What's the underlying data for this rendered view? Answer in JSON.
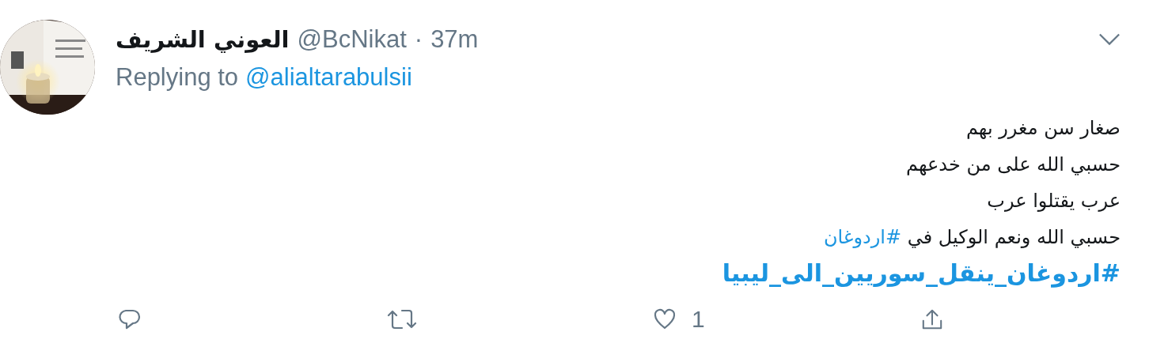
{
  "tweet": {
    "author_name": "العوني الشريف",
    "handle": "@BcNikat",
    "separator": "·",
    "time": "37m",
    "reply_prefix": "Replying to",
    "reply_to": "@alialtarabulsii",
    "lines": [
      {
        "bold": false,
        "segments": [
          {
            "kind": "text",
            "text": "صغار سن مغرر بهم"
          }
        ]
      },
      {
        "bold": false,
        "segments": [
          {
            "kind": "text",
            "text": "حسبي الله على من خدعهم"
          }
        ]
      },
      {
        "bold": false,
        "segments": [
          {
            "kind": "text",
            "text": "عرب يقتلوا عرب"
          }
        ]
      },
      {
        "bold": false,
        "segments": [
          {
            "kind": "text",
            "text": "حسبي الله ونعم الوكيل في "
          },
          {
            "kind": "hashtag",
            "text": "#اردوغان"
          }
        ]
      },
      {
        "bold": true,
        "segments": [
          {
            "kind": "hashtag",
            "text": "#اردوغان_ينقل_سوريين_الى_ليبيا"
          }
        ]
      }
    ],
    "actions": [
      {
        "kind": "reply"
      },
      {
        "kind": "retweet"
      },
      {
        "kind": "like",
        "count": "1"
      },
      {
        "kind": "share"
      }
    ]
  }
}
